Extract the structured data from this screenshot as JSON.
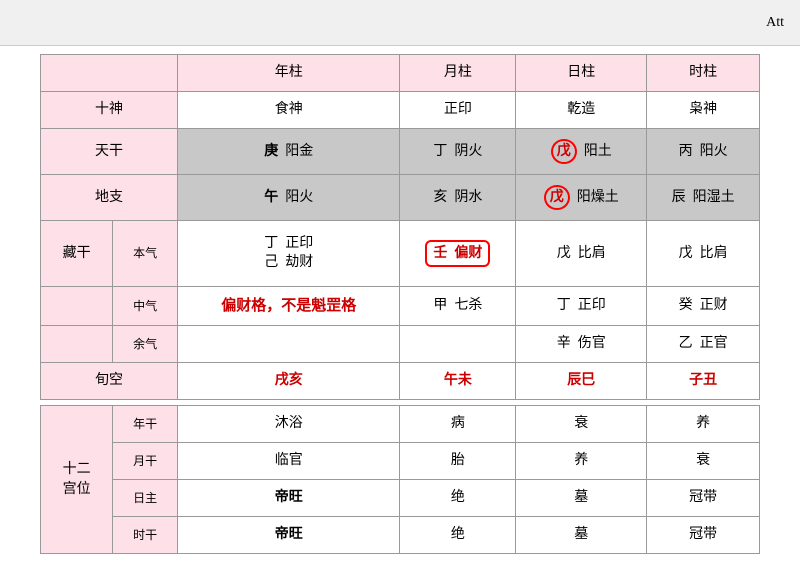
{
  "topbar": {
    "label": "Att"
  },
  "headers": {
    "col1": "年柱",
    "col2": "月柱",
    "col3": "日柱",
    "col4": "时柱"
  },
  "rows": {
    "shishen": {
      "label": "十神",
      "col1": "食神",
      "col2": "正印",
      "col3": "乾造",
      "col4": "枭神"
    },
    "tiangan": {
      "label": "天干",
      "col1_char": "庚",
      "col1_attr": "阳金",
      "col2_char": "丁",
      "col2_attr": "阴火",
      "col3_char": "戊",
      "col3_attr": "阳土",
      "col4_char": "丙",
      "col4_attr": "阳火"
    },
    "dizhi": {
      "label": "地支",
      "col1_char": "午",
      "col1_attr": "阳火",
      "col2_char": "亥",
      "col2_attr": "阴水",
      "col3_char": "戊",
      "col3_attr": "阳燥土",
      "col4_char": "辰",
      "col4_attr": "阳湿土"
    },
    "zanggan": {
      "label": "藏干",
      "sub1": "本气",
      "col1_a": "丁",
      "col1_b": "正印",
      "col1_c": "己",
      "col1_d": "劫财",
      "col2_a": "壬",
      "col2_b": "偏财",
      "col3_a": "戊",
      "col3_b": "比肩",
      "col4_a": "戊",
      "col4_b": "比肩"
    },
    "zhongqi": {
      "sub": "中气",
      "annotation": "偏财格，不是魁罡格",
      "col2_a": "甲",
      "col2_b": "七杀",
      "col3_a": "丁",
      "col3_b": "正印",
      "col4_a": "癸",
      "col4_b": "正财"
    },
    "yuqi": {
      "sub": "余气",
      "col3_a": "辛",
      "col3_b": "伤官",
      "col4_a": "乙",
      "col4_b": "正官"
    },
    "xunkong": {
      "label": "旬空",
      "col1": "戌亥",
      "col2": "午未",
      "col3": "辰巳",
      "col4": "子丑"
    }
  },
  "gongwei": {
    "label1": "十二",
    "label2": "宫位",
    "sub1": "年干",
    "sub2": "月干",
    "sub3": "日主",
    "sub4": "时干",
    "row1": {
      "col1": "沐浴",
      "col2": "病",
      "col3": "衰",
      "col4": "养"
    },
    "row2": {
      "col1": "临官",
      "col2": "胎",
      "col3": "养",
      "col4": "衰"
    },
    "row3": {
      "col1": "帝旺",
      "col1_bold": true,
      "col2": "绝",
      "col3": "墓",
      "col4": "冠带"
    },
    "row4": {
      "col1": "帝旺",
      "col1_bold": true,
      "col2": "绝",
      "col3": "墓",
      "col4": "冠带"
    }
  }
}
